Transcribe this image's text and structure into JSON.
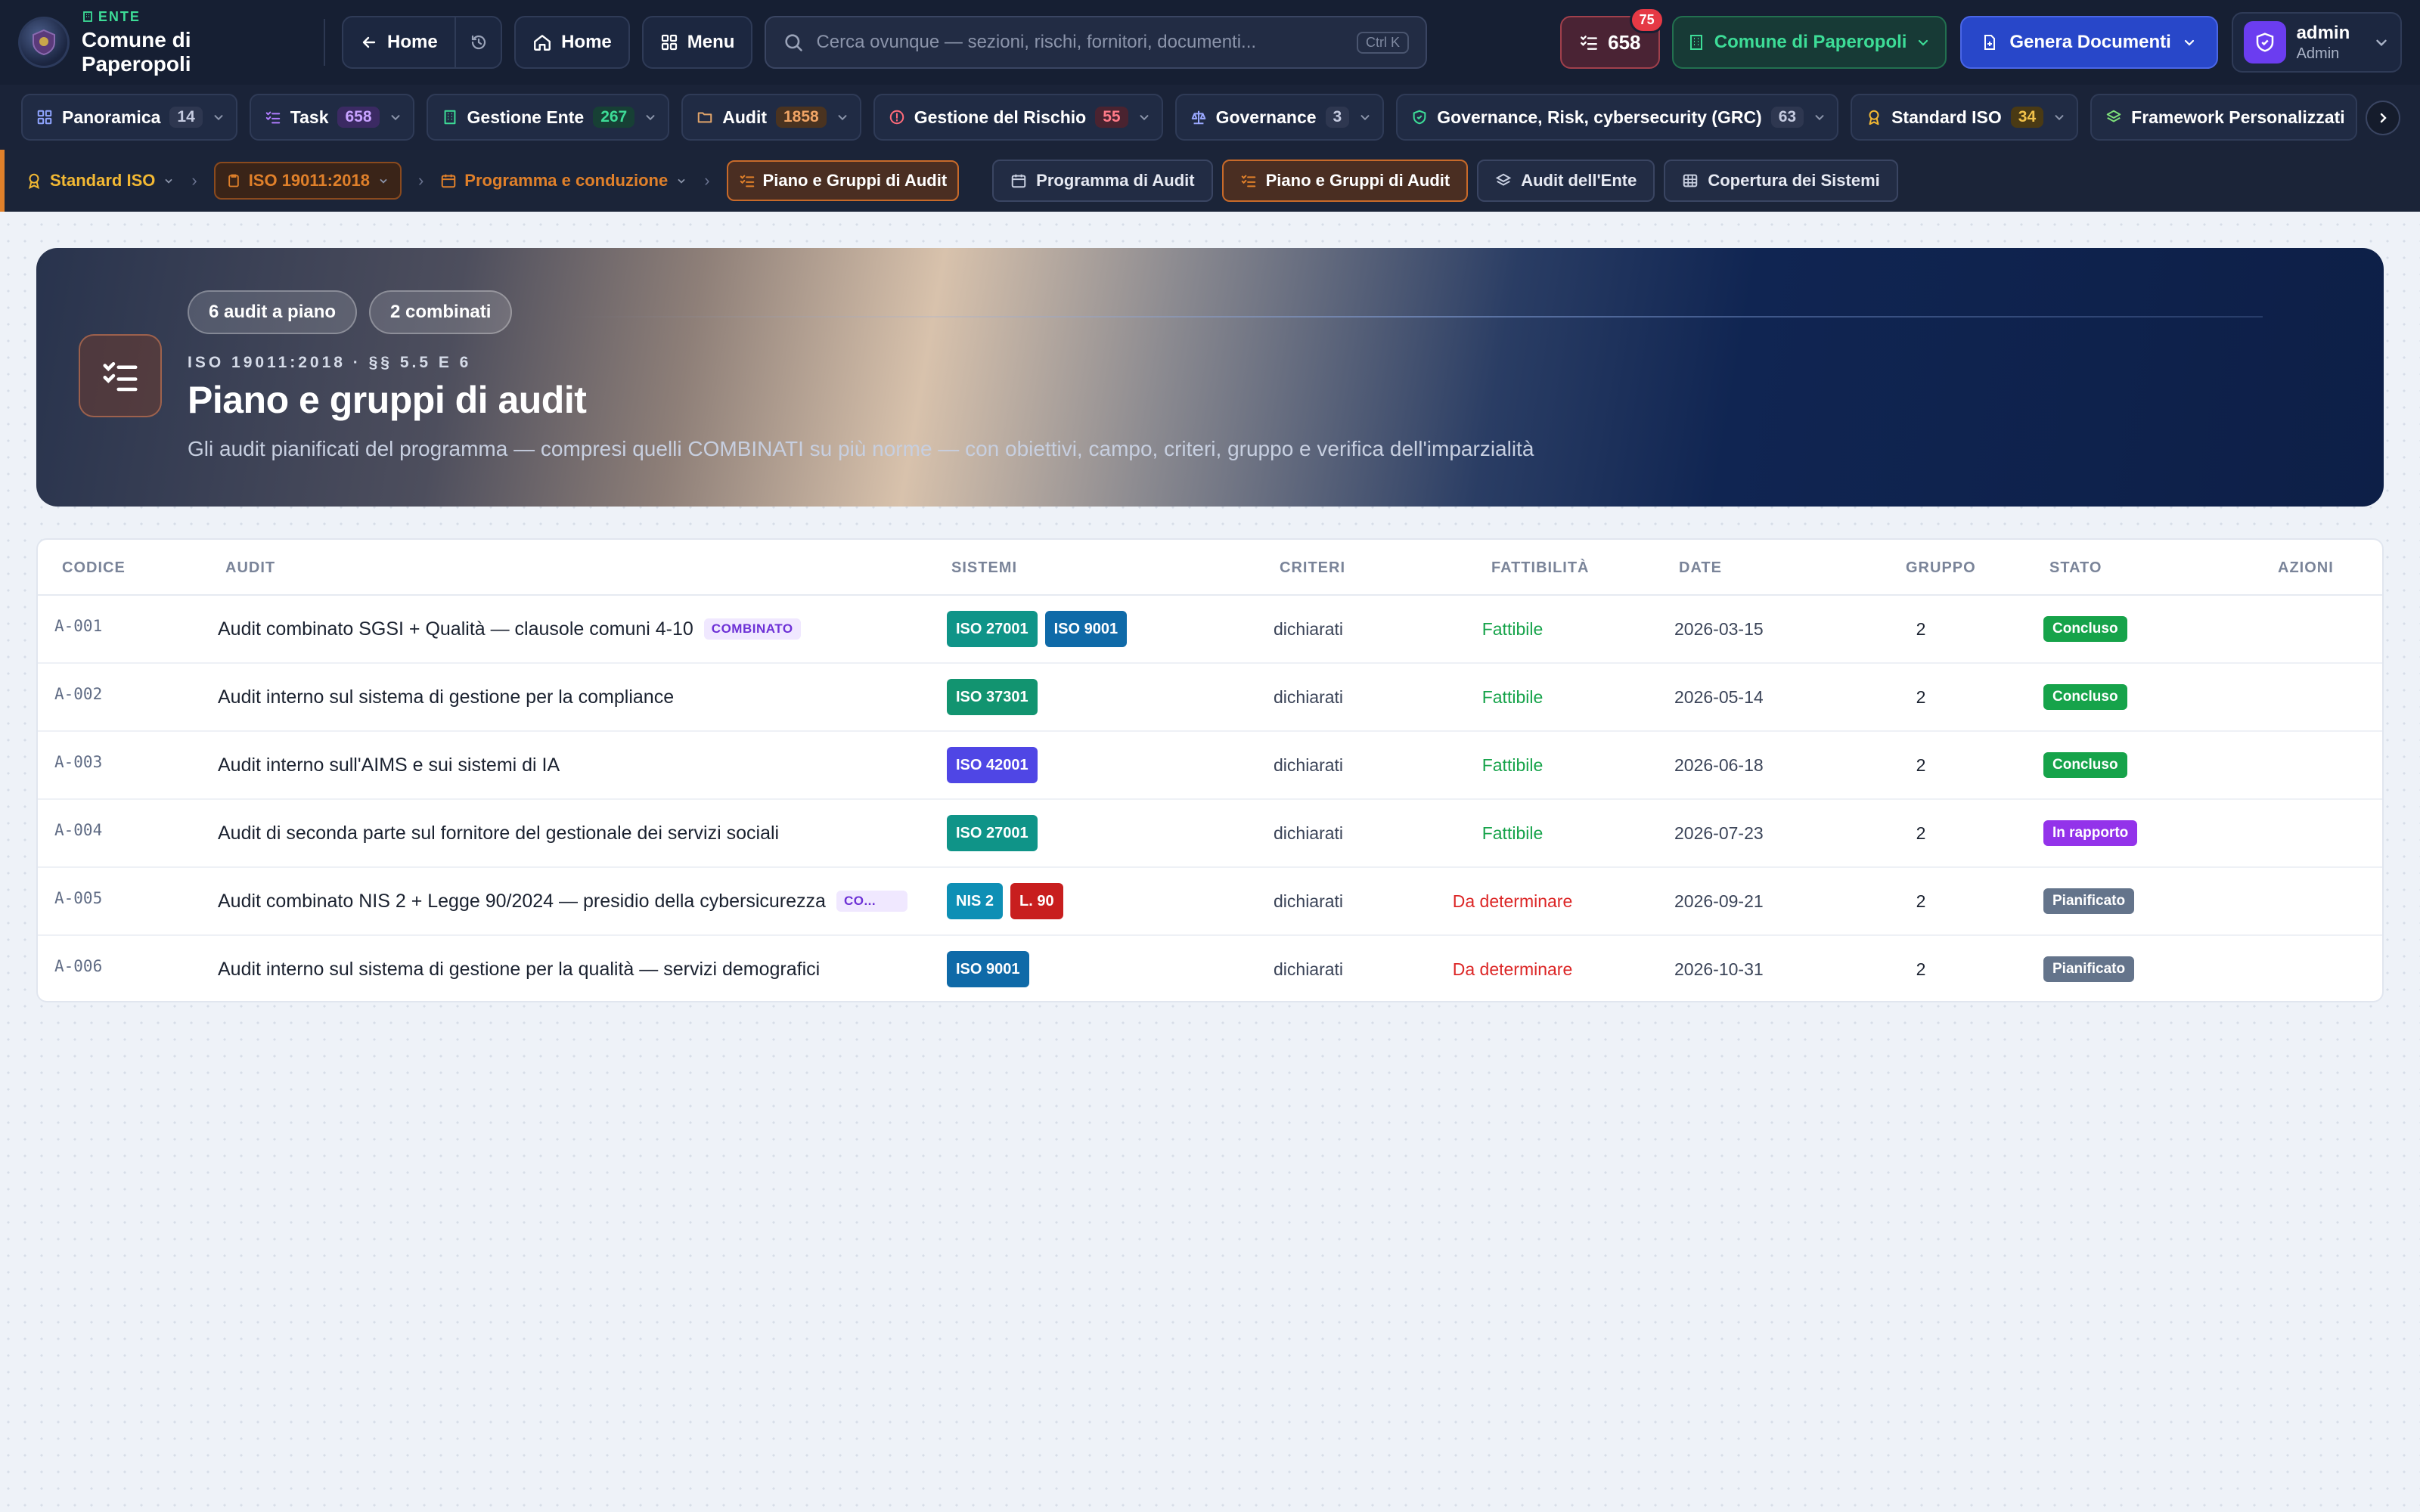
{
  "topbar": {
    "ente_tag": "ENTE",
    "ente_name": "Comune di Paperopoli",
    "back_home_label": "Home",
    "home_label": "Home",
    "menu_label": "Menu",
    "search_placeholder": "Cerca ovunque — sezioni, rischi, fornitori, documenti...",
    "search_shortcut": "Ctrl K",
    "task_count": "658",
    "task_badge": "75",
    "comune_label": "Comune di Paperopoli",
    "genera_label": "Genera Documenti",
    "user_name": "admin",
    "user_role": "Admin"
  },
  "modules": [
    {
      "label": "Panoramica",
      "count": "14",
      "icon": "grid-icon",
      "color": "#8fa4ff",
      "count_bg": "#2e3750",
      "count_color": "#c5cbe0"
    },
    {
      "label": "Task",
      "count": "658",
      "icon": "checklist-icon",
      "color": "#b07cff",
      "count_bg": "#3b2a63",
      "count_color": "#c7a2ff"
    },
    {
      "label": "Gestione Ente",
      "count": "267",
      "icon": "building-icon",
      "color": "#3ddc97",
      "count_bg": "#174035",
      "count_color": "#3ddc97"
    },
    {
      "label": "Audit",
      "count": "1858",
      "icon": "folder-icon",
      "color": "#e0a46a",
      "count_bg": "#4a3320",
      "count_color": "#f0a465"
    },
    {
      "label": "Gestione del Rischio",
      "count": "55",
      "icon": "alert-icon",
      "color": "#ff6b7a",
      "count_bg": "#4a2330",
      "count_color": "#ff7a88"
    },
    {
      "label": "Governance",
      "count": "3",
      "icon": "scale-icon",
      "color": "#9aa8ff",
      "count_bg": "#2e3750",
      "count_color": "#c5cbe0"
    },
    {
      "label": "Governance, Risk, cybersecurity (GRC)",
      "count": "63",
      "icon": "shield-check-icon",
      "color": "#3ddc97",
      "count_bg": "#2e3750",
      "count_color": "#c5cbe0"
    },
    {
      "label": "Standard ISO",
      "count": "34",
      "icon": "award-icon",
      "color": "#f2b833",
      "count_bg": "#4a3a14",
      "count_color": "#f2c24a"
    },
    {
      "label": "Framework Personalizzati",
      "count": "",
      "icon": "layers-icon",
      "color": "#7ee07a",
      "count_bg": "",
      "count_color": ""
    }
  ],
  "breadcrumb": [
    {
      "label": "Standard ISO",
      "icon": "award-icon"
    },
    {
      "label": "ISO 19011:2018",
      "icon": "clipboard-icon"
    },
    {
      "label": "Programma e conduzione",
      "icon": "calendar-icon"
    },
    {
      "label": "Piano e Gruppi di Audit",
      "icon": "checklist-icon"
    }
  ],
  "subtabs": [
    {
      "label": "Programma di Audit",
      "icon": "calendar-icon"
    },
    {
      "label": "Piano e Gruppi di Audit",
      "icon": "checklist-icon"
    },
    {
      "label": "Audit dell'Ente",
      "icon": "layers-icon"
    },
    {
      "label": "Copertura dei Sistemi",
      "icon": "table-icon"
    }
  ],
  "hero": {
    "pill_1": "6 audit a piano",
    "pill_2": "2 combinati",
    "kicker": "ISO 19011:2018 · §§ 5.5 E 6",
    "title": "Piano e gruppi di audit",
    "subtitle": "Gli audit pianificati del programma — compresi quelli COMBINATI su più norme — con obiettivi, campo, criteri, gruppo e verifica dell'imparzialità"
  },
  "table": {
    "headers": [
      "CODICE",
      "AUDIT",
      "SISTEMI",
      "CRITERI",
      "FATTIBILITÀ",
      "DATE",
      "GRUPPO",
      "STATO",
      "AZIONI"
    ],
    "rows": [
      {
        "code": "A-001",
        "title": "Audit combinato SGSI + Qualità — clausole comuni 4-10",
        "tag": "COMBINATO",
        "systems": [
          {
            "label": "ISO 27001",
            "color": "#0f9488"
          },
          {
            "label": "ISO 9001",
            "color": "#0f6aa8"
          }
        ],
        "criteria": "dichiarati",
        "feasibility": "Fattibile",
        "feas_color": "#16a34a",
        "date": "2026-03-15",
        "group": "2",
        "status": "Concluso",
        "status_color": "#16a34a"
      },
      {
        "code": "A-002",
        "title": "Audit interno sul sistema di gestione per la compliance",
        "tag": "",
        "systems": [
          {
            "label": "ISO 37301",
            "color": "#129470"
          }
        ],
        "criteria": "dichiarati",
        "feasibility": "Fattibile",
        "feas_color": "#16a34a",
        "date": "2026-05-14",
        "group": "2",
        "status": "Concluso",
        "status_color": "#16a34a"
      },
      {
        "code": "A-003",
        "title": "Audit interno sull'AIMS e sui sistemi di IA",
        "tag": "",
        "systems": [
          {
            "label": "ISO 42001",
            "color": "#4f46e5"
          }
        ],
        "criteria": "dichiarati",
        "feasibility": "Fattibile",
        "feas_color": "#16a34a",
        "date": "2026-06-18",
        "group": "2",
        "status": "Concluso",
        "status_color": "#16a34a"
      },
      {
        "code": "A-004",
        "title": "Audit di seconda parte sul fornitore del gestionale dei servizi sociali",
        "tag": "",
        "systems": [
          {
            "label": "ISO 27001",
            "color": "#0f9488"
          }
        ],
        "criteria": "dichiarati",
        "feasibility": "Fattibile",
        "feas_color": "#16a34a",
        "date": "2026-07-23",
        "group": "2",
        "status": "In rapporto",
        "status_color": "#9333ea"
      },
      {
        "code": "A-005",
        "title": "Audit combinato NIS 2 + Legge 90/2024 — presidio della cybersicurezza",
        "tag": "CO...",
        "systems": [
          {
            "label": "NIS 2",
            "color": "#0e8fb5"
          },
          {
            "label": "L. 90",
            "color": "#c81e1e"
          }
        ],
        "criteria": "dichiarati",
        "feasibility": "Da determinare",
        "feas_color": "#dc2626",
        "date": "2026-09-21",
        "group": "2",
        "status": "Pianificato",
        "status_color": "#64748b"
      },
      {
        "code": "A-006",
        "title": "Audit interno sul sistema di gestione per la qualità — servizi demografici",
        "tag": "",
        "systems": [
          {
            "label": "ISO 9001",
            "color": "#0f6aa8"
          }
        ],
        "criteria": "dichiarati",
        "feasibility": "Da determinare",
        "feas_color": "#dc2626",
        "date": "2026-10-31",
        "group": "2",
        "status": "Pianificato",
        "status_color": "#64748b"
      }
    ]
  }
}
